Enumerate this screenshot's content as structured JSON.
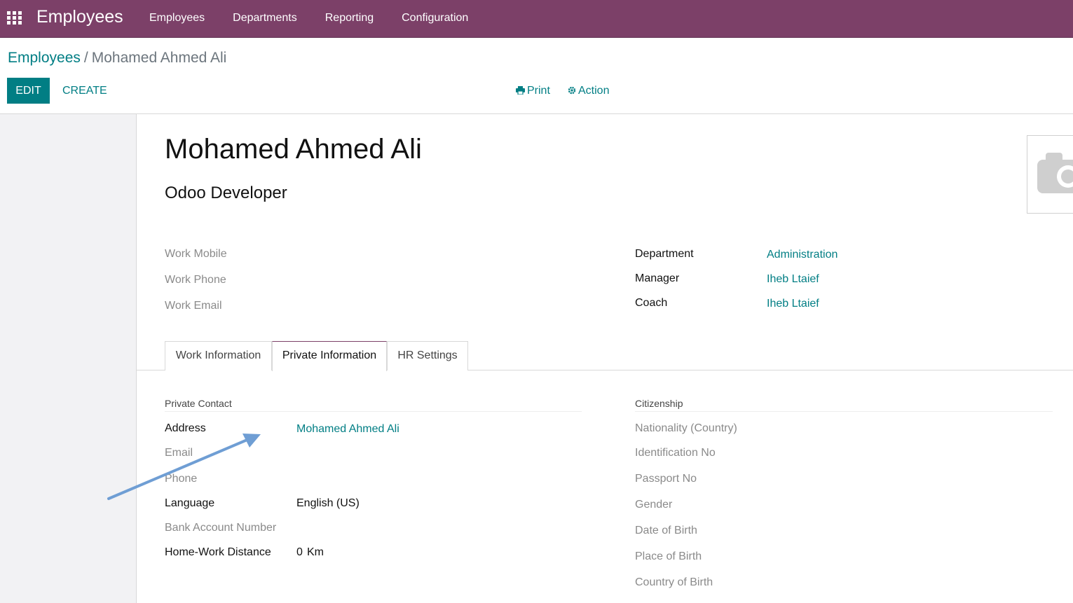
{
  "navbar": {
    "apps_icon": "grid-icon",
    "app_title": "Employees",
    "menu": [
      "Employees",
      "Departments",
      "Reporting",
      "Configuration"
    ],
    "background_color": "#7c4068"
  },
  "breadcrumb": {
    "parent": "Employees",
    "separator": "/",
    "current": "Mohamed Ahmed Ali"
  },
  "toolbar": {
    "edit_label": "EDIT",
    "create_label": "CREATE",
    "print_label": "Print",
    "print_icon": "printer-icon",
    "action_label": "Action",
    "action_icon": "gear-icon",
    "accent_color": "#017e84"
  },
  "employee": {
    "name": "Mohamed Ahmed Ali",
    "job_title": "Odoo Developer",
    "avatar_icon": "camera-icon"
  },
  "contact_fields": {
    "work_mobile_label": "Work Mobile",
    "work_phone_label": "Work Phone",
    "work_email_label": "Work Email"
  },
  "org_fields": {
    "department_label": "Department",
    "department_value": "Administration",
    "manager_label": "Manager",
    "manager_value": "Iheb Ltaief",
    "coach_label": "Coach",
    "coach_value": "Iheb Ltaief"
  },
  "tabs": [
    {
      "label": "Work Information",
      "active": false
    },
    {
      "label": "Private Information",
      "active": true
    },
    {
      "label": "HR Settings",
      "active": false
    }
  ],
  "private_contact": {
    "title": "Private Contact",
    "address_label": "Address",
    "address_value": "Mohamed Ahmed Ali",
    "email_label": "Email",
    "phone_label": "Phone",
    "language_label": "Language",
    "language_value": "English (US)",
    "bank_label": "Bank Account Number",
    "distance_label": "Home-Work Distance",
    "distance_value": "0",
    "distance_unit": "Km"
  },
  "citizenship": {
    "title": "Citizenship",
    "nationality_label": "Nationality (Country)",
    "identification_label": "Identification No",
    "passport_label": "Passport No",
    "gender_label": "Gender",
    "dob_label": "Date of Birth",
    "pob_label": "Place of Birth",
    "cob_label": "Country of Birth"
  },
  "annotation": {
    "arrow_color": "#6f9ed4"
  }
}
